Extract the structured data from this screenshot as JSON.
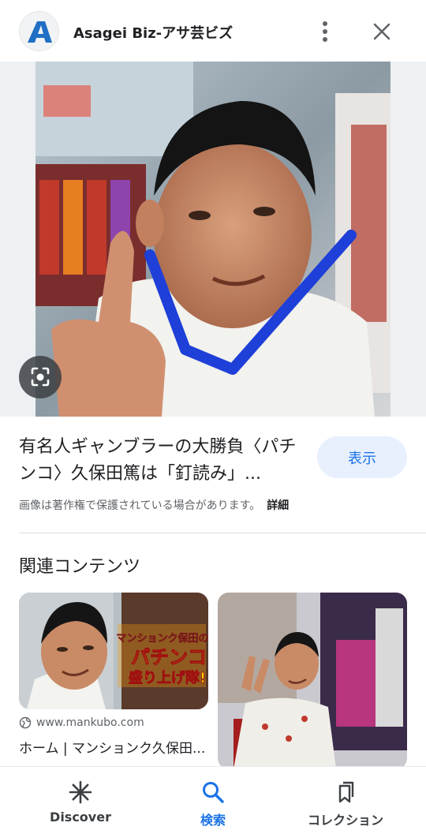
{
  "header": {
    "site_title": "Asagei Biz-アサ芸ビズ",
    "logo_letter": "A",
    "icons": {
      "more": "more-vert-icon",
      "close": "close-icon"
    }
  },
  "image": {
    "alt": "",
    "lens_icon": "lens-search-icon"
  },
  "result": {
    "title": "有名人ギャンブラーの大勝負〈パチンコ〉久保田篤は「釘読み」...",
    "view_button": "表示",
    "copyright_notice": "画像は著作権で保護されている場合があります。",
    "details_link": "詳細"
  },
  "related": {
    "heading": "関連コンテンツ",
    "cards": [
      {
        "source": "www.mankubo.com",
        "title": "ホーム | マンションク久保田...",
        "overlay_text": "マンションク保田のパチンコ盛り上げ隊!"
      },
      {
        "source": "",
        "title": ""
      }
    ]
  },
  "bottom_nav": {
    "items": [
      {
        "label": "Discover",
        "icon": "asterisk-icon"
      },
      {
        "label": "検索",
        "icon": "search-icon",
        "active": true
      },
      {
        "label": "コレクション",
        "icon": "collections-icon"
      }
    ]
  },
  "colors": {
    "accent": "#1a73e8",
    "button_bg": "#e8f0fe",
    "drawn_check": "#1e3fd8"
  }
}
